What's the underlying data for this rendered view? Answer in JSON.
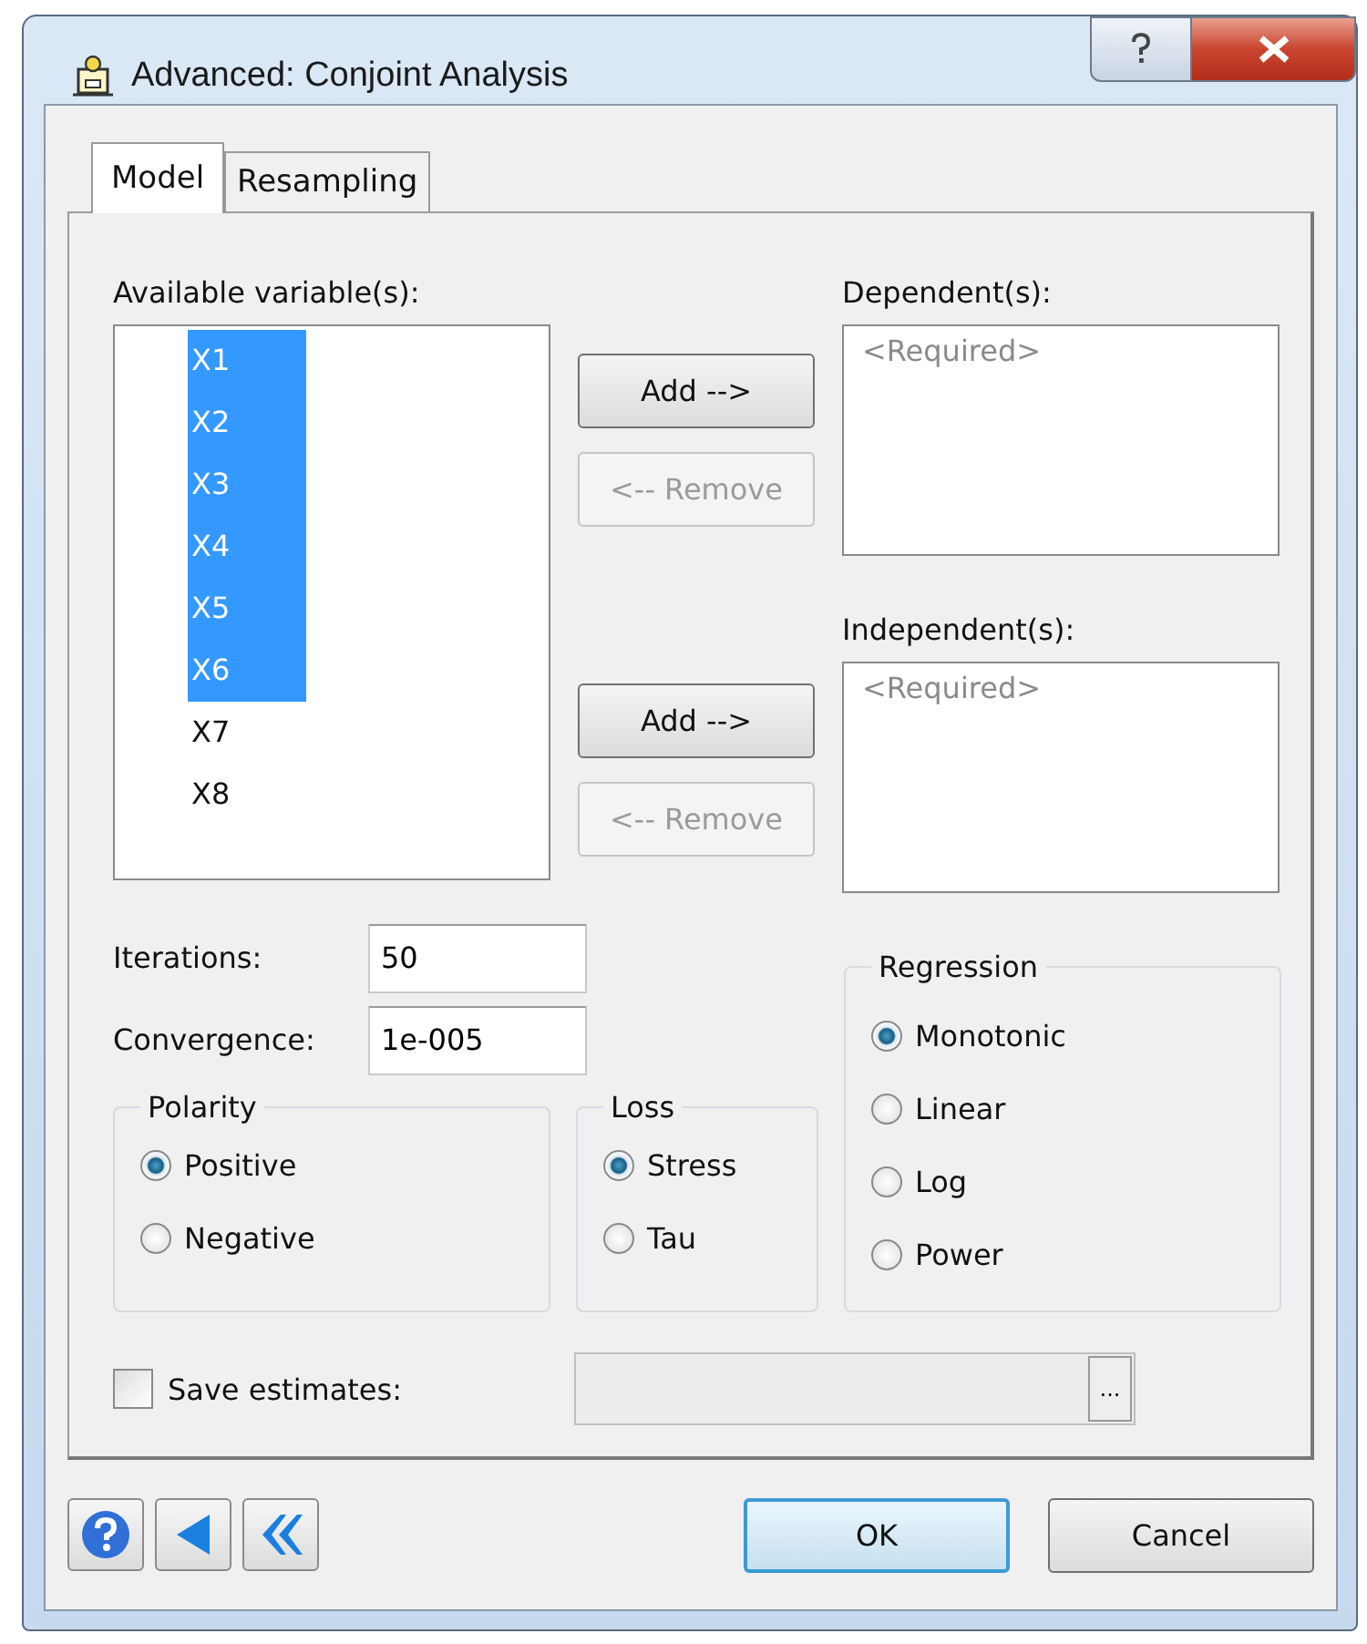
{
  "window": {
    "title": "Advanced: Conjoint Analysis"
  },
  "tabs": [
    {
      "label": "Model",
      "selected": true
    },
    {
      "label": "Resampling",
      "selected": false
    }
  ],
  "available": {
    "label": "Available variable(s):",
    "items": [
      {
        "label": "X1",
        "selected": true
      },
      {
        "label": "X2",
        "selected": true
      },
      {
        "label": "X3",
        "selected": true
      },
      {
        "label": "X4",
        "selected": true
      },
      {
        "label": "X5",
        "selected": true
      },
      {
        "label": "X6",
        "selected": true
      },
      {
        "label": "X7",
        "selected": false
      },
      {
        "label": "X8",
        "selected": false
      }
    ]
  },
  "transfer_buttons": [
    {
      "label": "Add -->",
      "disabled": false
    },
    {
      "label": "<-- Remove",
      "disabled": true
    },
    {
      "label": "Add -->",
      "disabled": false
    },
    {
      "label": "<-- Remove",
      "disabled": true
    }
  ],
  "dependents": {
    "label": "Dependent(s):",
    "placeholder": "<Required>"
  },
  "independents": {
    "label": "Independent(s):",
    "placeholder": "<Required>"
  },
  "iterations": {
    "label": "Iterations:",
    "value": "50"
  },
  "convergence": {
    "label": "Convergence:",
    "value": "1e-005"
  },
  "polarity": {
    "title": "Polarity",
    "options": [
      {
        "label": "Positive",
        "selected": true
      },
      {
        "label": "Negative",
        "selected": false
      }
    ]
  },
  "loss": {
    "title": "Loss",
    "options": [
      {
        "label": "Stress",
        "selected": true
      },
      {
        "label": "Tau",
        "selected": false
      }
    ]
  },
  "regression": {
    "title": "Regression",
    "options": [
      {
        "label": "Monotonic",
        "selected": true
      },
      {
        "label": "Linear",
        "selected": false
      },
      {
        "label": "Log",
        "selected": false
      },
      {
        "label": "Power",
        "selected": false
      }
    ]
  },
  "save_estimates": {
    "label": "Save estimates:",
    "checked": false,
    "field_disabled": true,
    "browse_label": "..."
  },
  "footer_buttons": [
    {
      "label": "OK",
      "default": true
    },
    {
      "label": "Cancel",
      "default": false
    }
  ]
}
